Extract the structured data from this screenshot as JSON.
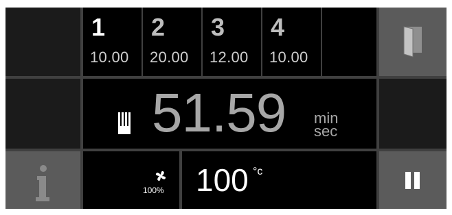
{
  "stages": [
    {
      "number": "1",
      "value": "10.00",
      "number_color": "#ffffff"
    },
    {
      "number": "2",
      "value": "20.00",
      "number_color": "#bdbdbd"
    },
    {
      "number": "3",
      "value": "12.00",
      "number_color": "#bdbdbd"
    },
    {
      "number": "4",
      "value": "10.00",
      "number_color": "#bdbdbd"
    }
  ],
  "timer": {
    "value": "51.59",
    "unit_top": "min",
    "unit_bottom": "sec",
    "mode_icon": "probe-icon"
  },
  "fan": {
    "icon": "fan-icon",
    "percent": "100%"
  },
  "temperature": {
    "value": "100",
    "unit": "°c"
  },
  "buttons": {
    "door": "door-icon",
    "info": "info-icon",
    "pause": "pause-icon"
  },
  "colors": {
    "background": "#404040",
    "cell": "#000000",
    "button_gray": "#5b5b5b",
    "dim_text": "#a7a7a7"
  }
}
